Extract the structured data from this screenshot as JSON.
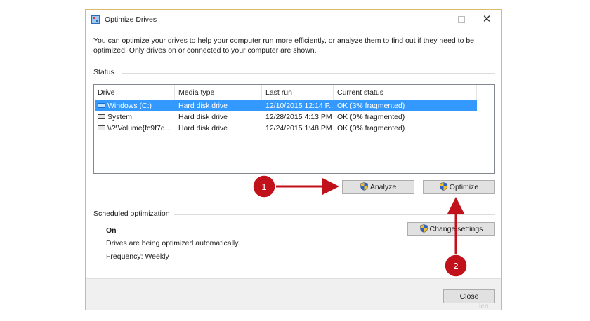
{
  "window": {
    "title": "Optimize Drives",
    "intro": "You can optimize your drives to help your computer run more efficiently, or analyze them to find out if they need to be optimized. Only drives on or connected to your computer are shown."
  },
  "status": {
    "label": "Status",
    "columns": [
      "Drive",
      "Media type",
      "Last run",
      "Current status"
    ],
    "drives": [
      {
        "drive": "Windows (C:)",
        "media_type": "Hard disk drive",
        "last_run": "12/10/2015 12:14 P...",
        "current_status": "OK (3% fragmented)",
        "selected": true,
        "icon": "windows-drive-icon"
      },
      {
        "drive": "System",
        "media_type": "Hard disk drive",
        "last_run": "12/28/2015 4:13 PM",
        "current_status": "OK (0% fragmented)",
        "selected": false,
        "icon": "hard-drive-icon"
      },
      {
        "drive": "\\\\?\\Volume{fc9f7d...",
        "media_type": "Hard disk drive",
        "last_run": "12/24/2015 1:48 PM",
        "current_status": "OK (0% fragmented)",
        "selected": false,
        "icon": "hard-drive-icon"
      }
    ]
  },
  "buttons": {
    "analyze": "Analyze",
    "optimize": "Optimize",
    "change_settings": "Change settings",
    "close": "Close"
  },
  "scheduled": {
    "label": "Scheduled optimization",
    "state": "On",
    "description": "Drives are being optimized automatically.",
    "frequency": "Frequency: Weekly"
  },
  "annotations": {
    "step1": "1",
    "step2": "2",
    "color": "#c1121c"
  },
  "watermark": "leru",
  "colors": {
    "selection": "#3399ff",
    "window_border": "#d9b96a",
    "annotation": "#c1121c"
  }
}
